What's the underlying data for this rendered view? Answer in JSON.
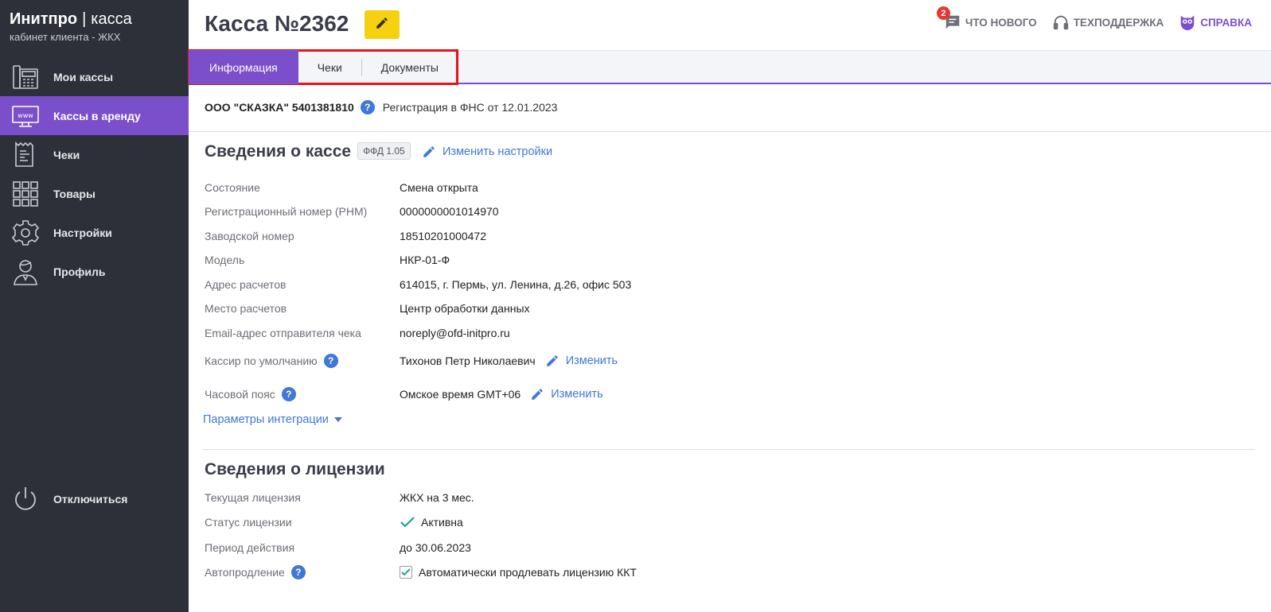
{
  "brand": {
    "name": "Инитпро",
    "separator": "|",
    "product": "касса",
    "subtitle": "кабинет клиента - ЖКХ"
  },
  "sidebar": {
    "items": [
      {
        "label": "Мои кассы",
        "icon": "cash-register-icon",
        "active": false
      },
      {
        "label": "Кассы в аренду",
        "icon": "www-monitor-icon",
        "active": true
      },
      {
        "label": "Чеки",
        "icon": "receipt-icon",
        "active": false
      },
      {
        "label": "Товары",
        "icon": "grid-icon",
        "active": false
      },
      {
        "label": "Настройки",
        "icon": "gear-icon",
        "active": false
      },
      {
        "label": "Профиль",
        "icon": "user-icon",
        "active": false
      }
    ],
    "logout": {
      "label": "Отключиться",
      "icon": "power-icon"
    }
  },
  "header": {
    "title": "Касса №2362",
    "links": [
      {
        "label": "Что нового",
        "icon": "chat-icon",
        "badge": "2"
      },
      {
        "label": "Техподдержка",
        "icon": "headset-icon"
      },
      {
        "label": "Справка",
        "icon": "owl-icon"
      }
    ]
  },
  "tabs": [
    {
      "label": "Информация",
      "active": true
    },
    {
      "label": "Чеки",
      "active": false
    },
    {
      "label": "Документы",
      "active": false
    }
  ],
  "org": {
    "name": "ООО \"СКАЗКА\" 5401381810",
    "registration": "Регистрация в ФНС от 12.01.2023"
  },
  "kassa_section": {
    "title": "Сведения о кассе",
    "ffd": "ФФД 1.05",
    "change_settings": "Изменить настройки",
    "rows": [
      {
        "key": "Состояние",
        "value": "Смена открыта"
      },
      {
        "key": "Регистрационный номер (РНМ)",
        "value": "0000000001014970"
      },
      {
        "key": "Заводской номер",
        "value": "18510201000472"
      },
      {
        "key": "Модель",
        "value": "НКР-01-Ф"
      },
      {
        "key": "Адрес расчетов",
        "value": "614015, г. Пермь, ул. Ленина, д.26, офис 503"
      },
      {
        "key": "Место расчетов",
        "value": "Центр обработки данных"
      },
      {
        "key": "Email-адрес отправителя чека",
        "value": "noreply@ofd-initpro.ru"
      }
    ],
    "cashier": {
      "key": "Кассир по умолчанию",
      "value": "Тихонов Петр Николаевич",
      "action": "Изменить"
    },
    "timezone": {
      "key": "Часовой пояс",
      "value": "Омское время GMT+06",
      "action": "Изменить"
    },
    "integration": "Параметры интеграции"
  },
  "license_section": {
    "title": "Сведения о лицензии",
    "current": {
      "key": "Текущая лицензия",
      "value": "ЖКХ на 3 мес."
    },
    "status": {
      "key": "Статус лицензии",
      "value": "Активна"
    },
    "period": {
      "key": "Период действия",
      "value": "до 30.06.2023"
    },
    "autorenew": {
      "key": "Автопродление",
      "value": "Автоматически продлевать лицензию ККТ",
      "checked": true
    }
  },
  "colors": {
    "sidebar_bg": "#2e3039",
    "accent": "#7b4fcb",
    "link": "#3f78d6",
    "edit_button": "#f6d110",
    "highlight_outline": "#e3141b",
    "success": "#2a9d8f"
  }
}
